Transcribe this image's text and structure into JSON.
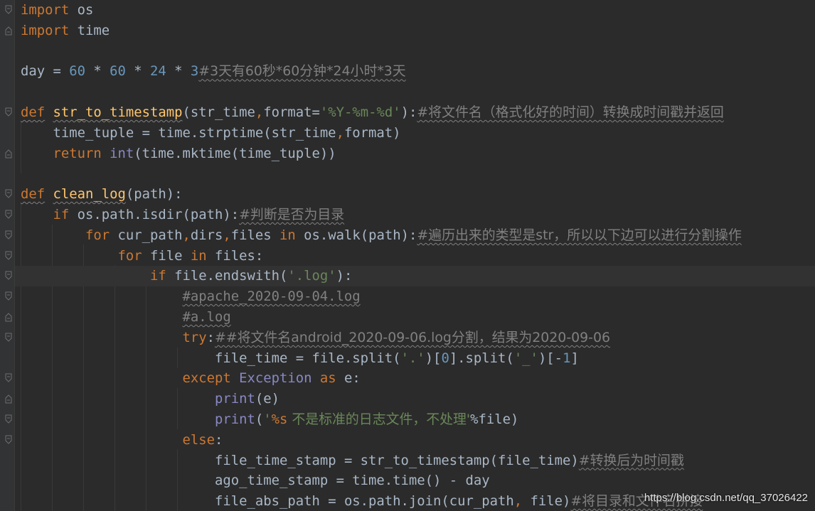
{
  "watermark": "https://blog.csdn.net/qq_37026422",
  "colors": {
    "background": "#2b2b2b",
    "keyword": "#cc7832",
    "function": "#ffc66d",
    "number": "#6897bb",
    "string": "#6a8759",
    "comment": "#808080",
    "builtin": "#8888c6",
    "text": "#a9b7c6"
  },
  "code": {
    "line_1": {
      "kw": "import",
      "rest": " os"
    },
    "line_2": {
      "kw": "import",
      "rest": " time"
    },
    "line_4": {
      "var": "day = ",
      "n1": "60",
      "op1": " * ",
      "n2": "60",
      "op2": " * ",
      "n3": "24",
      "op3": " * ",
      "n4": "3",
      "comment": "#3天有60秒*60分钟*24小时*3天"
    },
    "line_6": {
      "kw": "def",
      "fn": "str_to_timestamp",
      "args_1": "(str_time",
      "comma": ",",
      "args_2": "format=",
      "str": "'%Y-%m-%d'",
      "close": "):",
      "comment": "#将文件名（格式化好的时间）转换成时间戳并返回"
    },
    "line_7": {
      "text_1": "time_tuple = time.strptime(str_time",
      "comma": ",",
      "text_2": "format)"
    },
    "line_8": {
      "kw": "return",
      "bi": "int",
      "rest": "(time.mktime(time_tuple))"
    },
    "line_10": {
      "kw": "def",
      "fn": "clean_log",
      "rest": "(path):"
    },
    "line_11": {
      "kw": "if",
      "rest": " os.path.isdir(path):",
      "comment": "#判断是否为目录"
    },
    "line_12": {
      "kw": "for",
      "t1": " cur_path",
      "c1": ",",
      "t2": "dirs",
      "c2": ",",
      "t3": "files ",
      "kw2": "in",
      "t4": " os.walk(path):",
      "comment": "#遍历出来的类型是str，所以以下边可以进行分割操作"
    },
    "line_13": {
      "kw": "for",
      "t1": " file ",
      "kw2": "in",
      "t2": " files:"
    },
    "line_14": {
      "kw": "if",
      "t1": " file.endswith(",
      "str": "'.log'",
      "t2": "):"
    },
    "line_15": {
      "comment": "#apache_2020-09-04.log"
    },
    "line_16": {
      "comment": "#a.log"
    },
    "line_17": {
      "kw": "try",
      "colon": ":",
      "comment": "##将文件名android_2020-09-06.log分割，结果为2020-09-06"
    },
    "line_18": {
      "t1": "file_time = file.split(",
      "s1": "'.'",
      "t2": ")[",
      "n1": "0",
      "t3": "].split(",
      "s2": "'_'",
      "t4": ")[-",
      "n2": "1",
      "t5": "]"
    },
    "line_19": {
      "kw": "except",
      "bi": " Exception ",
      "kw2": "as",
      "rest": " e:"
    },
    "line_20": {
      "bi": "print",
      "rest": "(e)"
    },
    "line_21": {
      "bi": "print",
      "open": "(",
      "s1": "'",
      "fmt": "%s",
      "s2": " 不是标准的日志文件，不处理'",
      "rest": "%file)"
    },
    "line_22": {
      "kw": "else",
      "colon": ":"
    },
    "line_23": {
      "t1": "file_time_stamp = str_to_timestamp(file_time)",
      "comment": "#转换后为时间戳"
    },
    "line_24": {
      "t1": "ago_time_stamp = time.time() - day"
    },
    "line_25": {
      "t1": "file_abs_path = os.path.join(cur_path",
      "comma": ",",
      "t2": " file)",
      "comment": "#将目录和文件名拼接"
    }
  }
}
